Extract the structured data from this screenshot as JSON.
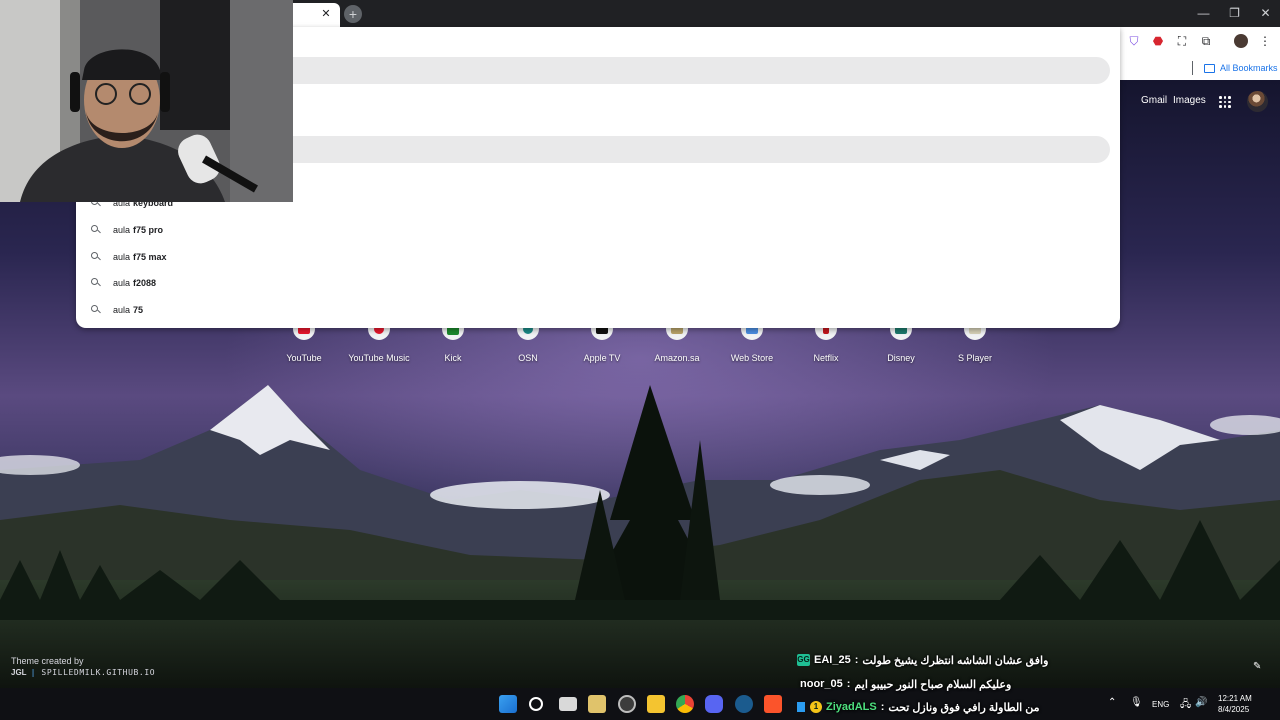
{
  "browser": {
    "tab_close_glyph": "✕",
    "newtab_glyph": "+",
    "window_controls": [
      "—",
      "❐",
      "✕"
    ],
    "bookmarks": {
      "all_bookmarks_label": "All Bookmarks"
    }
  },
  "omnibox": {
    "suggestions": [
      {
        "prefix": "aula",
        "completion": "keyboard"
      },
      {
        "prefix": "aula",
        "completion": "f75 pro"
      },
      {
        "prefix": "aula",
        "completion": "f75 max"
      },
      {
        "prefix": "aula",
        "completion": "f2088"
      },
      {
        "prefix": "aula",
        "completion": "75"
      }
    ]
  },
  "google_header": {
    "gmail_label": "Gmail",
    "images_label": "Images"
  },
  "shortcuts": [
    {
      "label": "YouTube",
      "icon": "youtube-icon",
      "color": "#e8172d"
    },
    {
      "label": "YouTube Music",
      "icon": "youtube-music-icon",
      "color": "#e8172d"
    },
    {
      "label": "Kick",
      "icon": "kick-icon",
      "color": "#1c8a2e"
    },
    {
      "label": "OSN",
      "icon": "osn-icon",
      "color": "#1a8a86"
    },
    {
      "label": "Apple TV",
      "icon": "apple-tv-icon",
      "color": "#111111"
    },
    {
      "label": "Amazon.sa",
      "icon": "amazon-icon",
      "color": "#b9a46a"
    },
    {
      "label": "Web Store",
      "icon": "web-store-icon",
      "color": "#4b8ee2"
    },
    {
      "label": "Netflix",
      "icon": "netflix-icon",
      "color": "#c4161d"
    },
    {
      "label": "Disney",
      "icon": "disney-icon",
      "color": "#1d7a6d"
    },
    {
      "label": "S Player",
      "icon": "s-player-icon",
      "color": "#d7d2b8"
    }
  ],
  "theme_credit": {
    "line1": "Theme created by",
    "brand": "JGL",
    "site": "SPILLEDMILK.GITHUB.IO"
  },
  "chat": [
    {
      "user": "EAI_25",
      "badge": "GG",
      "message": "وافق عشان الشاشه انتظرك يشيخ طولت"
    },
    {
      "user": "noor_05",
      "badge": "",
      "message": "وعليكم السلام صباح النور حبيبو ايم"
    },
    {
      "user": "ZiyadALS",
      "badge": "1",
      "message": "من الطاولة رافي فوق ونازل تحت"
    }
  ],
  "taskbar": {
    "apps": [
      {
        "name": "start-button",
        "color": "#3aa0f0"
      },
      {
        "name": "search-button",
        "color": "#ffffff"
      },
      {
        "name": "task-view-button",
        "color": "#d9d9d9"
      },
      {
        "name": "store-app",
        "color": "#e0c36b"
      },
      {
        "name": "obs-app",
        "color": "#bdbdbd"
      },
      {
        "name": "file-explorer-app",
        "color": "#f4c430"
      },
      {
        "name": "chrome-app",
        "color": "#4285f4"
      },
      {
        "name": "discord-app",
        "color": "#5865f2"
      },
      {
        "name": "steam-app",
        "color": "#1b5b8e"
      },
      {
        "name": "brave-app",
        "color": "#fb542b"
      }
    ],
    "tray": {
      "language": "ENG",
      "time": "12:21 AM",
      "date": "8/4/2025"
    }
  }
}
